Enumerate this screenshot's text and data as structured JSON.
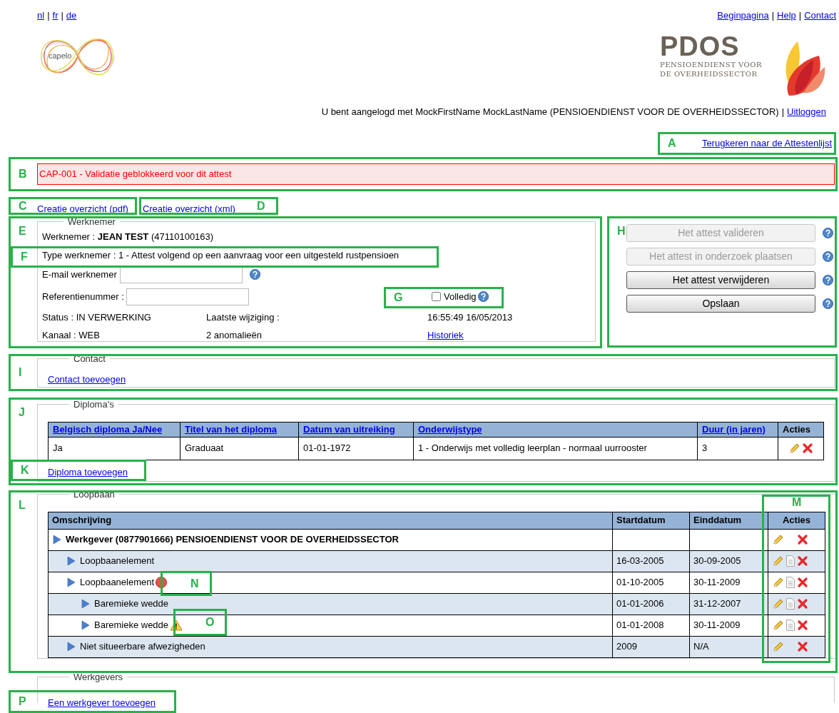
{
  "language_links": [
    "nl",
    "fr",
    "de"
  ],
  "language_separators": [
    "|",
    "|"
  ],
  "top_links": [
    "Beginpagina",
    "Help",
    "Contact"
  ],
  "top_link_separators": [
    "|",
    "|"
  ],
  "capelo_logo": {
    "text": "capelo"
  },
  "pdos_logo": {
    "title": "PDOS",
    "subtitle_lines": [
      "PENSIOENDIENST VOOR",
      "DE OVERHEIDSSECTOR"
    ]
  },
  "login": {
    "text": "U bent aangelogd met MockFirstName MockLastName (PENSIOENDIENST VOOR DE OVERHEIDSSECTOR)",
    "separator": "|",
    "logout": "Uitloggen"
  },
  "back_link": "Terugkeren naar de Attestenlijst",
  "error_message": "CAP-001 - Validatie geblokkeerd voor dit attest",
  "overview_links": [
    "Creatie overzicht (pdf)",
    "Creatie overzicht (xml)"
  ],
  "werknemer": {
    "legend": "Werknemer",
    "employee": "Werknemer : **JEAN TEST** (47110100163)",
    "type": "Type werknemer : 1 - Attest volgend op een aanvraag voor een uitgesteld rustpensioen",
    "email_label": "E-mail werknemer",
    "reference_label": "Referentienummer :",
    "volledig": {
      "label": "Volledig",
      "checked": false
    },
    "status": "Status : IN VERWERKING",
    "last_change_label": "Laatste wijziging :",
    "last_change": "16:55:49 16/05/2013",
    "channel": "Kanaal : WEB",
    "anomalies": "2 anomalieën",
    "history_link": "Historiek"
  },
  "actions": [
    {
      "label": "Het attest valideren",
      "disabled": true
    },
    {
      "label": "Het attest in onderzoek plaatsen",
      "disabled": true
    },
    {
      "label": "Het attest verwijderen",
      "disabled": false
    },
    {
      "label": "Opslaan",
      "disabled": false
    }
  ],
  "contact": {
    "legend": "Contact",
    "add_link": "Contact toevoegen"
  },
  "diplomas": {
    "legend": "Diploma's",
    "columns": [
      {
        "label": "Belgisch diploma Ja/Nee",
        "sortable": true
      },
      {
        "label": "Titel van het diploma",
        "sortable": true
      },
      {
        "label": "Datum van uitreiking",
        "sortable": true
      },
      {
        "label": "Onderwijstype",
        "sortable": true
      },
      {
        "label": "Duur (in jaren)",
        "sortable": true
      },
      {
        "label": "Acties",
        "sortable": false
      }
    ],
    "rows": [
      {
        "cells": [
          "Ja",
          "Graduaat",
          "01-01-1972",
          "1 - Onderwijs met volledig leerplan - normaal uurrooster",
          "3"
        ]
      }
    ],
    "add_link": "Diploma toevoegen"
  },
  "loopbaan": {
    "legend": "Loopbaan",
    "columns": [
      "Omschrijving",
      "Startdatum",
      "Einddatum",
      "Acties"
    ],
    "rows": [
      {
        "label": "Werkgever (0877901666) PENSIOENDIENST VOOR DE OVERHEIDSSECTOR",
        "copy": false,
        "children": [
          {
            "label": "Loopbaanelement",
            "start": "16-03-2005",
            "end": "30-09-2005",
            "copy": true
          },
          {
            "label": "Loopbaanelement",
            "start": "01-10-2005",
            "end": "30-11-2009",
            "copy": true,
            "has_error": true,
            "children": [
              {
                "label": "Baremieke wedde",
                "start": "01-01-2006",
                "end": "31-12-2007",
                "copy": true
              },
              {
                "label": "Baremieke wedde",
                "start": "01-01-2008",
                "end": "30-11-2009",
                "copy": true,
                "has_warning": true
              }
            ]
          },
          {
            "label": "Niet situeerbare afwezigheden",
            "start": "2009",
            "end": "N/A",
            "copy": false
          }
        ]
      }
    ]
  },
  "werkgevers": {
    "legend": "Werkgevers",
    "add_link": "Een werkgever toevoegen"
  },
  "annotations": [
    {
      "label": "A"
    },
    {
      "label": "B"
    },
    {
      "label": "C"
    },
    {
      "label": "D"
    },
    {
      "label": "E"
    },
    {
      "label": "F"
    },
    {
      "label": "G"
    },
    {
      "label": "H"
    },
    {
      "label": "I"
    },
    {
      "label": "J"
    },
    {
      "label": "K"
    },
    {
      "label": "L"
    },
    {
      "label": "M"
    },
    {
      "label": "N"
    },
    {
      "label": "O"
    },
    {
      "label": "P"
    }
  ]
}
